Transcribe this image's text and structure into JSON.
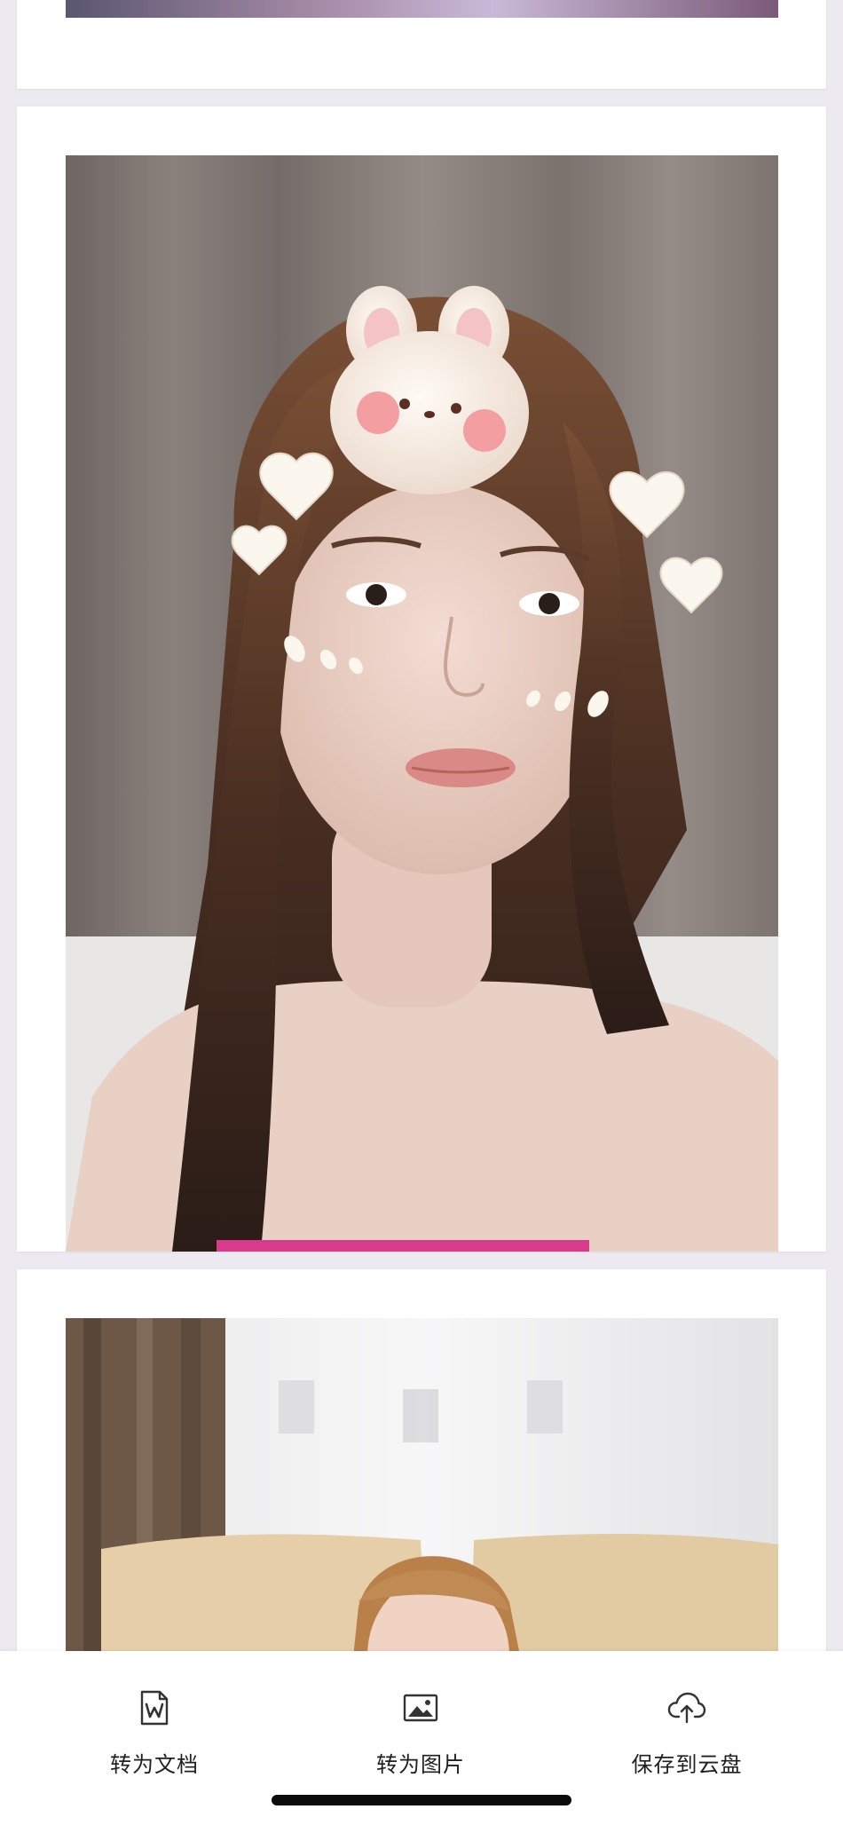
{
  "toolbar": {
    "items": [
      {
        "label": "转为文档",
        "icon": "word-document-icon"
      },
      {
        "label": "转为图片",
        "icon": "image-icon"
      },
      {
        "label": "保存到云盘",
        "icon": "cloud-upload-icon"
      }
    ]
  },
  "colors": {
    "background": "#eceaf0",
    "card": "#ffffff",
    "icon_stroke": "#333333",
    "text": "#1f1f1f"
  }
}
